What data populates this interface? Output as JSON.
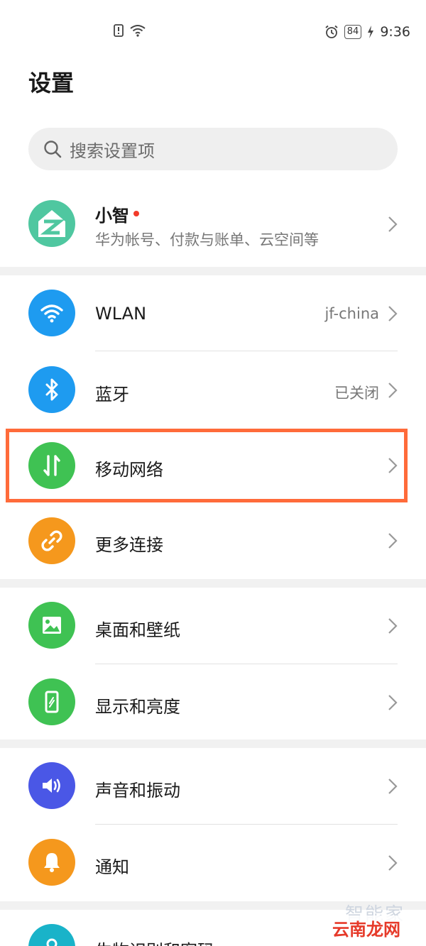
{
  "status_bar": {
    "battery": "84",
    "time": "9:36"
  },
  "title": "设置",
  "search": {
    "placeholder": "搜索设置项"
  },
  "profile": {
    "name": "小智",
    "subtitle": "华为帐号、付款与账单、云空间等"
  },
  "items": [
    {
      "label": "WLAN",
      "value": "jf-china",
      "icon": "wifi-icon",
      "color": "#1e9bf0"
    },
    {
      "label": "蓝牙",
      "value": "已关闭",
      "icon": "bluetooth-icon",
      "color": "#1e9bf0"
    },
    {
      "label": "移动网络",
      "value": "",
      "icon": "mobile-data-icon",
      "color": "#3fc253"
    },
    {
      "label": "更多连接",
      "value": "",
      "icon": "link-icon",
      "color": "#f5981d"
    },
    {
      "label": "桌面和壁纸",
      "value": "",
      "icon": "wallpaper-icon",
      "color": "#3fc253"
    },
    {
      "label": "显示和亮度",
      "value": "",
      "icon": "display-icon",
      "color": "#3fc253"
    },
    {
      "label": "声音和振动",
      "value": "",
      "icon": "sound-icon",
      "color": "#4a57e6"
    },
    {
      "label": "通知",
      "value": "",
      "icon": "bell-icon",
      "color": "#f5981d"
    },
    {
      "label": "生物识别和密码",
      "value": "",
      "icon": "fingerprint-icon",
      "color": "#19b3c9"
    }
  ],
  "watermark": {
    "ghost": "智能家",
    "text": "云南龙网"
  }
}
